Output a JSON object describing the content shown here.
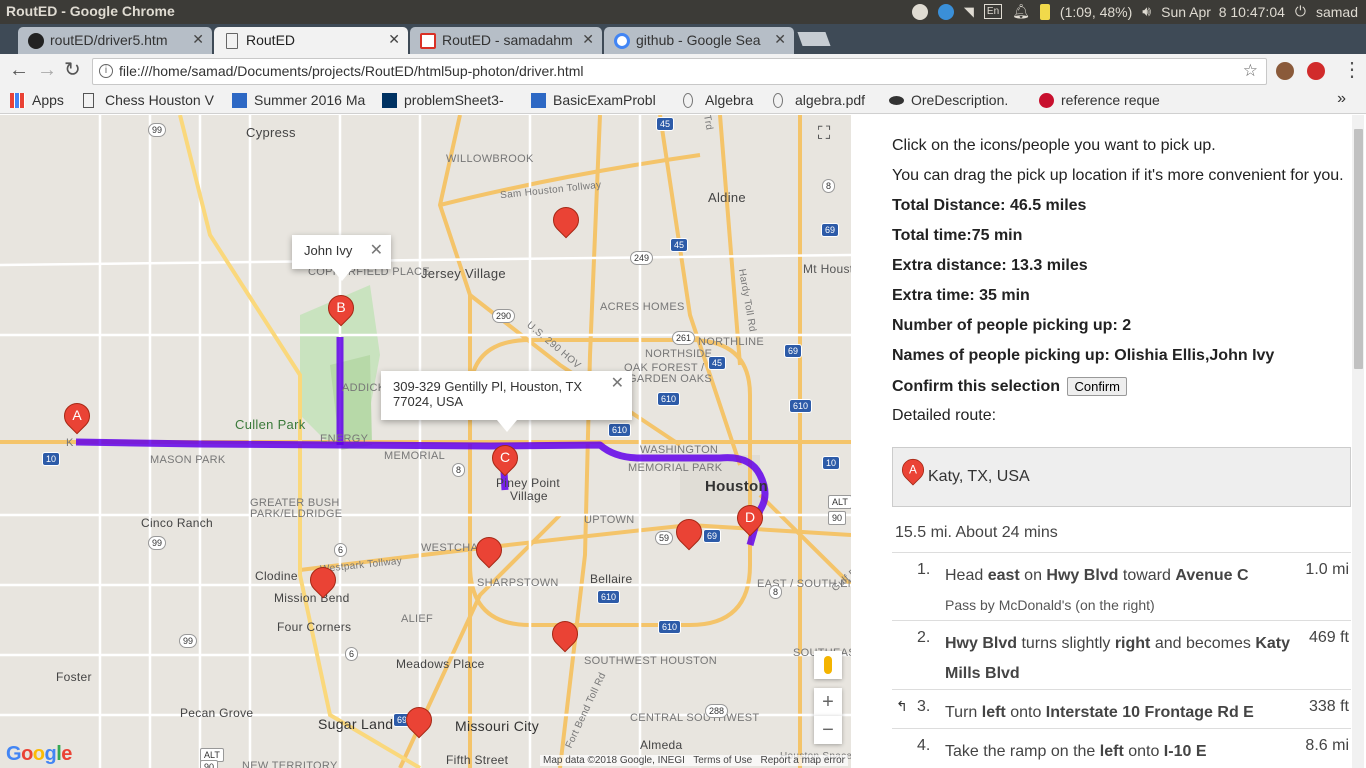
{
  "os": {
    "window_title": "RoutED - Google Chrome",
    "language": "En",
    "battery": "(1:09, 48%)",
    "clock": "Sun Apr  8 10:47:04",
    "user": "samad"
  },
  "tabs": [
    {
      "label": "routED/driver5.htm",
      "icon": "github-icon"
    },
    {
      "label": "RoutED",
      "icon": "page-icon"
    },
    {
      "label": "RoutED - samadahm",
      "icon": "gmail-icon"
    },
    {
      "label": "github - Google Sea",
      "icon": "google-icon"
    }
  ],
  "toolbar": {
    "url": "file:///home/samad/Documents/projects/RoutED/html5up-photon/driver.html"
  },
  "bookmarks": [
    {
      "label": "Apps"
    },
    {
      "label": "Chess Houston V"
    },
    {
      "label": "Summer 2016 Ma"
    },
    {
      "label": "problemSheet3-"
    },
    {
      "label": "BasicExamProbl"
    },
    {
      "label": "Algebra"
    },
    {
      "label": "algebra.pdf"
    },
    {
      "label": "OreDescription."
    },
    {
      "label": "reference reque"
    }
  ],
  "map": {
    "labels": {
      "cypress": "Cypress",
      "willowbrook": "WILLOWBROOK",
      "aldine": "Aldine",
      "sam_houston": "Sam Houston Tollway",
      "jersey_village": "Jersey Village",
      "copperfield": "COPPERFIELD PLACE",
      "mt_houston": "Mt Houst",
      "acres_homes": "ACRES HOMES",
      "us290": "U.S. 290 HOV",
      "northside": "NORTHSIDE",
      "northline": "NORTHLINE",
      "oak_forest": "OAK FOREST /",
      "garden_oaks": "GARDEN OAKS",
      "addicks": "ADDICKS",
      "cullen_park": "Cullen Park",
      "energy_corridor": "ENERGY",
      "memorial_road": "MEMORIAL",
      "washington": "WASHINGTON",
      "memorial_park": "MEMORIAL PARK",
      "mason_park": "MASON PARK",
      "piney_point": "Piney Point",
      "piney_point_village": "Village",
      "houston": "Houston",
      "greater_bush": "GREATER BUSH",
      "park_eldridge": "PARK/ELDRIDGE",
      "cinco_ranch": "Cinco Ranch",
      "uptown": "UPTOWN",
      "westchase": "WESTCHASE",
      "westpark": "Westpark Tollway",
      "clodine": "Clodine",
      "mission_bend": "Mission Bend",
      "sharpstown": "SHARPSTOWN",
      "bellaire": "Bellaire",
      "east_south_end": "EAST / SOUTH END",
      "four_corners": "Four Corners",
      "alief": "ALIEF",
      "southwest_houston": "SOUTHWEST HOUSTON",
      "southeast_houston": "SOUTHEAST HOUSTO",
      "meadows_place": "Meadows Place",
      "foster": "Foster",
      "pecan_grove": "Pecan Grove",
      "sugar_land": "Sugar Land",
      "missouri_city": "Missouri City",
      "central_southwest": "CENTRAL SOUTHWEST",
      "almeda": "Almeda",
      "new_territory": "NEW TERRITORY",
      "fifth_street": "Fifth Street",
      "hardy_toll": "Hardy Toll Rd",
      "gulf_fwy": "Gulf F",
      "ft_bend_toll": "Fort Bend Toll Rd",
      "katy_abbr": "K",
      "trd": "Trd",
      "houston_spaceport": "Houston Space"
    },
    "shields": {
      "s99a": "99",
      "s45a": "45",
      "s8a": "8",
      "s45b": "45",
      "s69a": "69",
      "s249": "249",
      "s290": "290",
      "s261": "261",
      "s69b": "69",
      "s45c": "45",
      "s10a": "10",
      "s8b": "8",
      "s610a": "610",
      "s610b": "610",
      "s610c": "610",
      "s10b": "10",
      "s10c": "10",
      "salt": "ALT",
      "s90": "90",
      "s99b": "99",
      "s6a": "6",
      "s6b": "6",
      "s59": "59",
      "s69c": "69",
      "s610d": "610",
      "s610e": "610",
      "s288": "288",
      "s99c": "99",
      "s6c": "6",
      "s69d": "69",
      "s8c": "8",
      "salt2": "ALT",
      "s90b": "90"
    },
    "markers": {
      "a": "A",
      "b": "B",
      "c": "C",
      "d": "D"
    },
    "info_b": "John Ivy",
    "info_c": "309-329 Gentilly Pl, Houston, TX 77024, USA",
    "close_glyph": "✕",
    "zoom_in": "+",
    "zoom_out": "−",
    "footer_data": "Map data ©2018 Google, INEGI",
    "footer_terms": "Terms of Use",
    "footer_report": "Report a map error",
    "logo": "Google",
    "logo_colors": [
      "#4285f4",
      "#ea4335",
      "#fbbc05",
      "#4285f4",
      "#34a853",
      "#ea4335"
    ],
    "route_color": "#6200ea"
  },
  "sidebar": {
    "instruction_1": "Click on the icons/people you want to pick up.",
    "instruction_2": "You can drag the pick up location if it's more convenient for you.",
    "total_distance": "Total Distance: 46.5 miles",
    "total_time": "Total time:75 min",
    "extra_distance": "Extra distance: 13.3 miles",
    "extra_time": "Extra time: 35 min",
    "num_people": "Number of people picking up: 2",
    "names": "Names of people picking up: Olishia Ellis,John Ivy",
    "confirm_prompt": "Confirm this selection",
    "confirm_label": "Confirm",
    "detailed_route": "Detailed route:",
    "start_marker": "A",
    "start_address": "Katy, TX, USA",
    "leg_summary": "15.5 mi. About 24 mins",
    "steps": [
      {
        "num": "1.",
        "pre": "Head ",
        "b1": "east",
        "mid1": " on ",
        "b2": "Hwy Blvd",
        "mid2": " toward ",
        "b3": "Avenue C",
        "sub": "Pass by McDonald's (on the right)",
        "dist": "1.0 mi"
      },
      {
        "num": "2.",
        "b1": "Hwy Blvd",
        "mid1": " turns slightly ",
        "b2": "right",
        "mid2": " and becomes ",
        "b3": "Katy Mills Blvd",
        "dist": "469 ft"
      },
      {
        "num": "3.",
        "pre": "Turn ",
        "b1": "left",
        "mid1": " onto ",
        "b2": "Interstate 10 Frontage Rd E",
        "dist": "338 ft"
      },
      {
        "num": "4.",
        "pre": "Take the ramp on the ",
        "b1": "left",
        "mid1": " onto ",
        "b2": "I-10 E",
        "dist": "8.6 mi"
      }
    ]
  }
}
